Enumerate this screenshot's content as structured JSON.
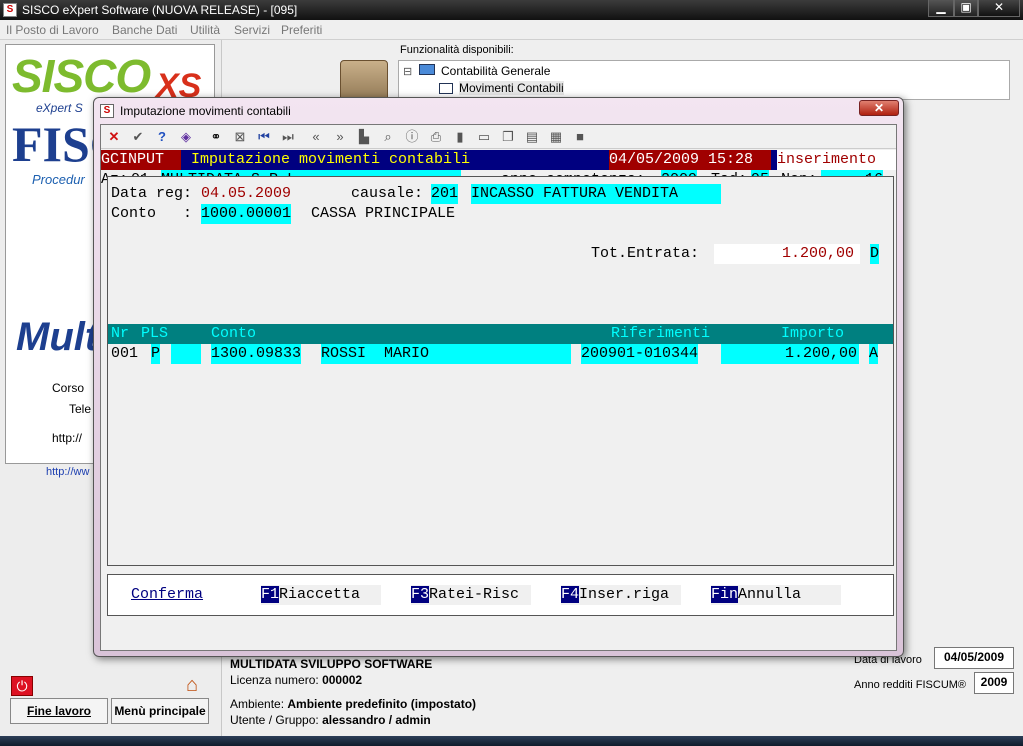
{
  "window": {
    "title": "SISCO eXpert Software (NUOVA RELEASE) - [095]",
    "app_icon": "S",
    "minimize": "▁",
    "restore": "▣",
    "close": "✕"
  },
  "menu": [
    "Il Posto di Lavoro",
    "Banche Dati",
    "Utilità",
    "Servizi",
    "Preferiti"
  ],
  "sidebar": {
    "logo_top": "SISCO",
    "logo_badge": "XS",
    "logo_sub": "eXpert S",
    "logo_fisco": "FISC",
    "logo_proc": "Procedur",
    "logo_mult": "Mult",
    "info_corso": "Corso",
    "info_tel": "Tele",
    "info_http": "http://",
    "link": "http://ww",
    "fine_lavoro": "Fine lavoro",
    "menu_principale": "Menù principale"
  },
  "functions": {
    "label": "Funzionalità disponibili:",
    "tree_expand": "⊟",
    "item1": "Contabilità Generale",
    "item2": "Movimenti Contabili"
  },
  "dialog": {
    "title": "Imputazione movimenti contabili",
    "close": "✕",
    "header": {
      "code": "GCINPUT",
      "title": "Imputazione movimenti contabili",
      "datetime": "04/05/2009 15:28",
      "mode": "inserimento"
    },
    "company": {
      "az_label": "Az:",
      "az_code": "01",
      "name": "MULTIDATA S.R.L.",
      "anno_label": "anno competenza:",
      "anno": "2009",
      "tad_label": "Tad:",
      "tad": "95",
      "nop_label": "Nop:",
      "nop": "16"
    },
    "form": {
      "data_reg_label": "Data reg:",
      "data_reg": "04.05.2009",
      "causale_label": "causale:",
      "causale_code": "201",
      "causale_desc": "INCASSO FATTURA VENDITA",
      "conto_label": "Conto   :",
      "conto_code": "1000.00001",
      "conto_desc": "CASSA PRINCIPALE",
      "tot_label": "Tot.Entrata:",
      "tot_value": "1.200,00",
      "tot_sign": "D"
    },
    "table": {
      "headers": {
        "nr": "Nr",
        "pls": "PLS",
        "conto": "Conto",
        "riferimenti": "Riferimenti",
        "importo": "Importo"
      },
      "rows": [
        {
          "nr": "001",
          "p": "P",
          "conto": "1300.09833",
          "desc": "ROSSI  MARIO",
          "rif": "200901-010344",
          "importo": "1.200,00",
          "sign": "A"
        }
      ]
    },
    "footer": {
      "conferma": "Conferma",
      "f1": "F1",
      "f1_label": "Riaccetta",
      "f3": "F3",
      "f3_label": "Ratei-Risc",
      "f4": "F4",
      "f4_label": "Inser.riga",
      "fin": "Fin",
      "fin_label": "Annulla"
    }
  },
  "bottom": {
    "company": "MULTIDATA SVILUPPO SOFTWARE",
    "licenza_label": "Licenza numero:",
    "licenza": "000002",
    "ambiente_label": "Ambiente:",
    "ambiente": "Ambiente predefinito (impostato)",
    "utente_label": "Utente / Gruppo:",
    "utente": "alessandro / admin",
    "data_lavoro_label": "Data di lavoro",
    "data_lavoro": "04/05/2009",
    "anno_redditi_label": "Anno redditi FISCUM®",
    "anno_redditi": "2009"
  }
}
